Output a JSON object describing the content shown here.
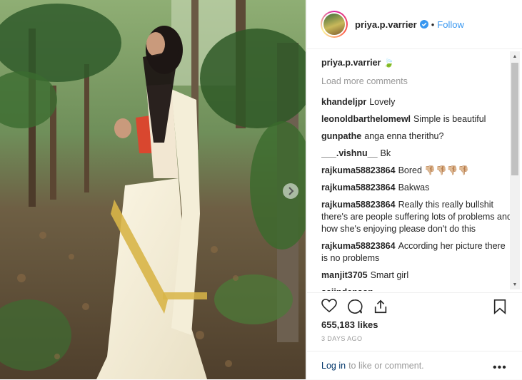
{
  "post": {
    "username": "priya.p.varrier",
    "follow_label": "Follow",
    "dot": "•"
  },
  "caption": {
    "username": "priya.p.varrier",
    "text": "🍃"
  },
  "load_more": "Load more comments",
  "comments": [
    {
      "user": "khandeljpr",
      "text": "Lovely"
    },
    {
      "user": "leonoldbarthelomewl",
      "text": "Simple is beautiful"
    },
    {
      "user": "gunpathe",
      "text": "anga enna therithu?"
    },
    {
      "user": "___.vishnu__",
      "text": "Bk"
    },
    {
      "user": "rajkuma58823864",
      "text": "Bored 👎🏼👎🏼👎🏼👎🏼"
    },
    {
      "user": "rajkuma58823864",
      "text": "Bakwas"
    },
    {
      "user": "rajkuma58823864",
      "text": "Really this really bullshit there's are people suffering lots of problems and how she's enjoying please don't do this"
    },
    {
      "user": "rajkuma58823864",
      "text": "According her picture there is no problems"
    },
    {
      "user": "manjit3705",
      "text": "Smart girl"
    },
    {
      "user": "sajindenson",
      "text": "."
    }
  ],
  "likes": "655,183 likes",
  "time_ago": "3 DAYS AGO",
  "footer": {
    "login_label": "Log in",
    "rest_text": "to like or comment.",
    "more_label": "•••"
  },
  "icons": [
    "heart-icon",
    "comment-icon",
    "share-icon",
    "bookmark-icon",
    "verified-badge-icon",
    "chevron-right-icon"
  ],
  "colors": {
    "accent": "#3897f0",
    "verified": "#3897f0",
    "link": "#003569",
    "muted": "#999999"
  }
}
